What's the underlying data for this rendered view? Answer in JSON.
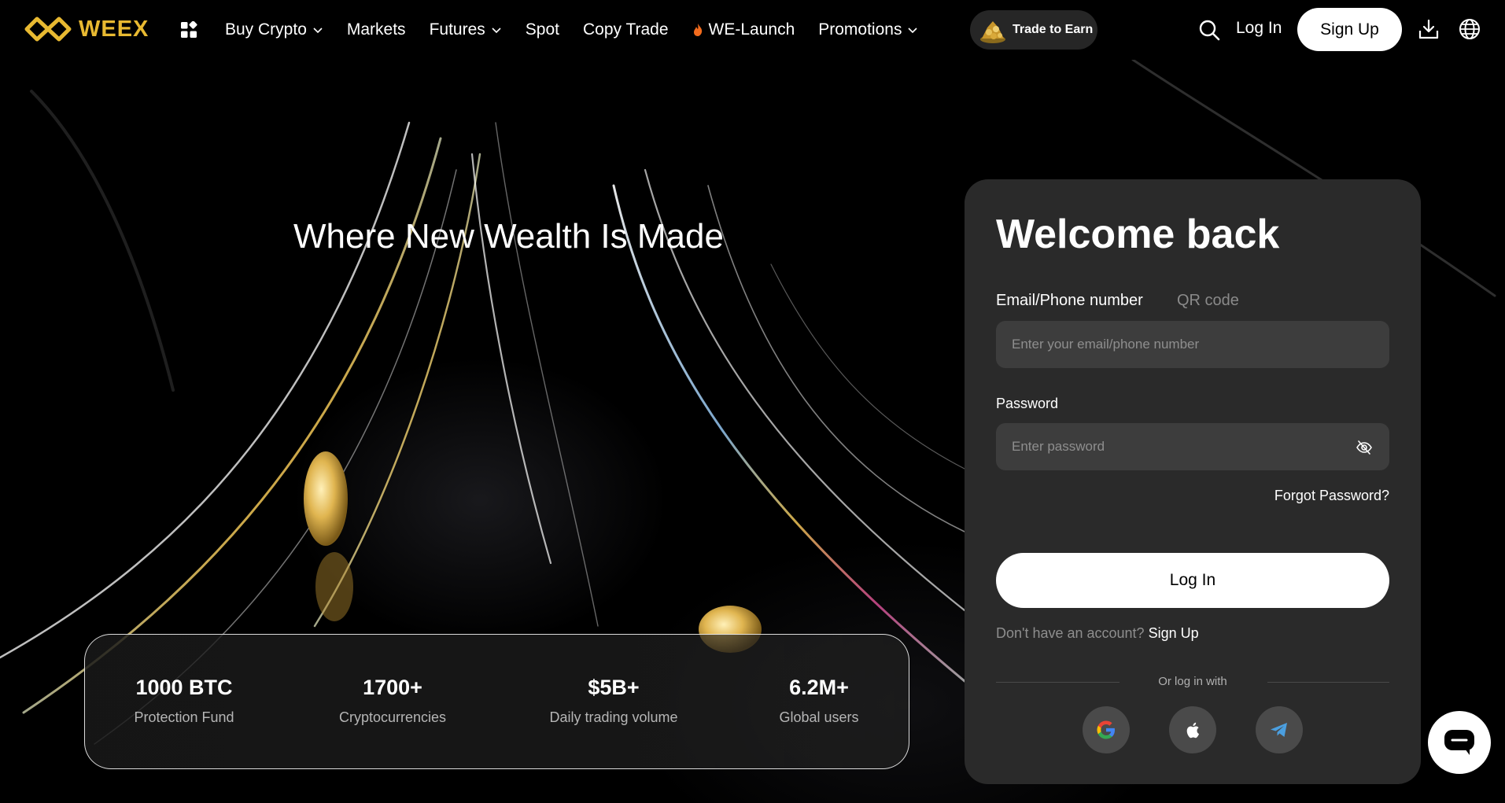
{
  "brand": {
    "name": "WEEX",
    "accent": "#e8b931"
  },
  "nav": {
    "items": [
      {
        "label": "Buy Crypto",
        "has_dropdown": true
      },
      {
        "label": "Markets",
        "has_dropdown": false
      },
      {
        "label": "Futures",
        "has_dropdown": true
      },
      {
        "label": "Spot",
        "has_dropdown": false
      },
      {
        "label": "Copy Trade",
        "has_dropdown": false
      },
      {
        "label": "WE-Launch",
        "has_dropdown": false,
        "icon": "fire-icon"
      },
      {
        "label": "Promotions",
        "has_dropdown": true
      }
    ],
    "trade_to_earn": "Trade to Earn",
    "login": "Log In",
    "signup": "Sign Up"
  },
  "hero": {
    "title": "Where New Wealth Is Made",
    "stats": [
      {
        "value": "1000 BTC",
        "label": "Protection Fund"
      },
      {
        "value": "1700+",
        "label": "Cryptocurrencies"
      },
      {
        "value": "$5B+",
        "label": "Daily trading volume"
      },
      {
        "value": "6.2M+",
        "label": "Global users"
      }
    ]
  },
  "login_card": {
    "title": "Welcome back",
    "tabs": {
      "active": "Email/Phone number",
      "inactive": "QR code"
    },
    "email_placeholder": "Enter your email/phone number",
    "password_label": "Password",
    "password_placeholder": "Enter password",
    "forgot": "Forgot Password?",
    "login_button": "Log In",
    "no_account": "Don't have an account?",
    "signup_link": "Sign Up",
    "or_login_with": "Or log in with",
    "social": [
      "google-icon",
      "apple-icon",
      "telegram-icon"
    ]
  }
}
